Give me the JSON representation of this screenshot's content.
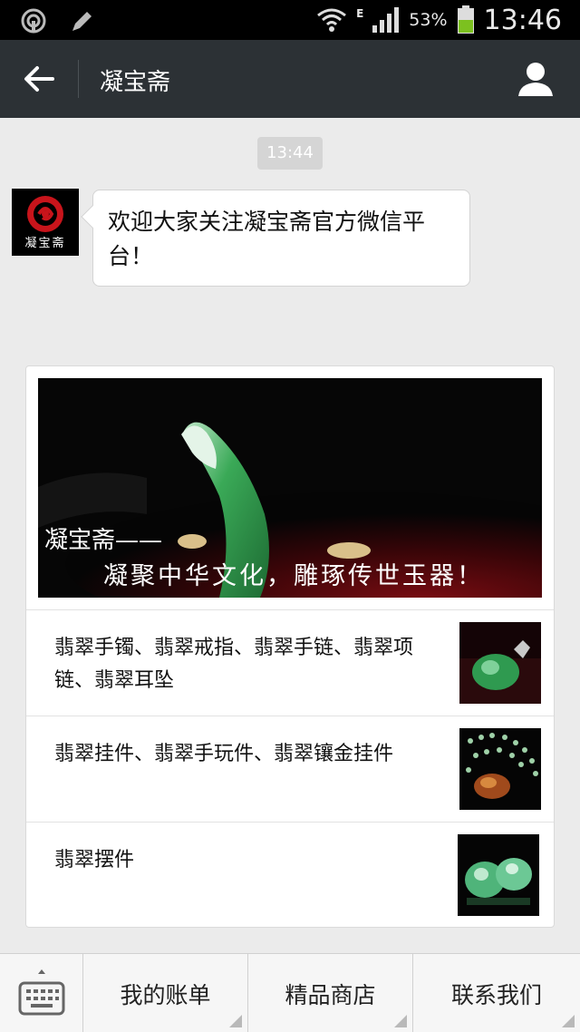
{
  "status_bar": {
    "network_type": "E",
    "battery": "53%",
    "time": "13:46"
  },
  "header": {
    "title": "凝宝斋"
  },
  "chat": {
    "timestamp": "13:44",
    "avatar_caption": "凝宝斋",
    "welcome_message": "欢迎大家关注凝宝斋官方微信平台！"
  },
  "news_card": {
    "cover_brand": "凝宝斋——",
    "cover_slogan": "凝聚中华文化，雕琢传世玉器！",
    "items": [
      {
        "title": "翡翠手镯、翡翠戒指、翡翠手链、翡翠项链、翡翠耳坠"
      },
      {
        "title": "翡翠挂件、翡翠手玩件、翡翠镶金挂件"
      },
      {
        "title": "翡翠摆件"
      }
    ]
  },
  "bottom_menu": {
    "items": [
      {
        "label": "我的账单"
      },
      {
        "label": "精品商店"
      },
      {
        "label": "联系我们"
      }
    ]
  },
  "colors": {
    "status_bar_bg": "#000000",
    "title_bar_bg": "#2c3135",
    "chat_bg": "#ebebeb",
    "jade_green": "#2e9a4e"
  }
}
